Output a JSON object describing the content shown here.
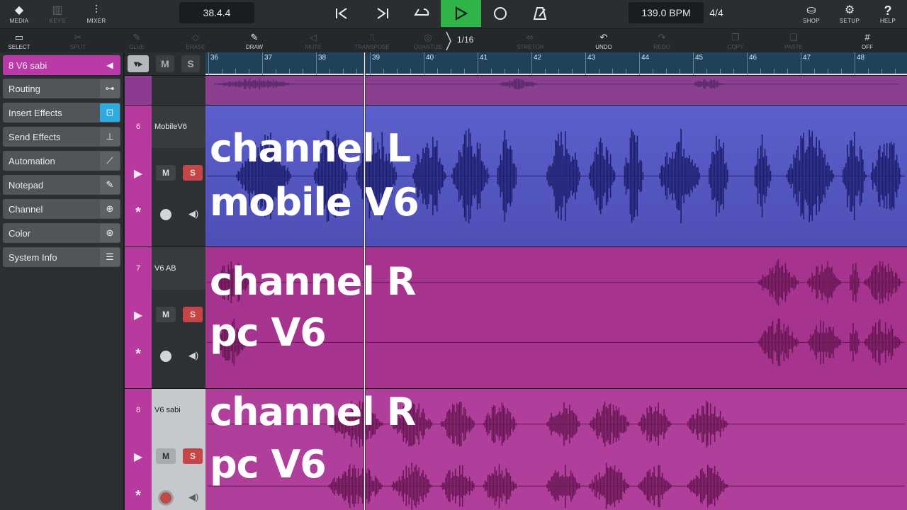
{
  "topbar": {
    "media_label": "MEDIA",
    "keys_label": "KEYS",
    "mixer_label": "MIXER",
    "position": "38.4.4",
    "tempo": "139.0 BPM",
    "signature": "4/4",
    "shop_label": "SHOP",
    "setup_label": "SETUP",
    "help_label": "HELP"
  },
  "tools": {
    "select": "SELECT",
    "split": "SPLIT",
    "glue": "GLUE",
    "erase": "ERASE",
    "draw": "DRAW",
    "mute": "MUTE",
    "transpose": "TRANSPOSE",
    "quantize": "QUANTIZE",
    "quantize_value": "1/16",
    "stretch": "STRETCH",
    "undo": "UNDO",
    "redo": "REDO",
    "copy": "COPY",
    "paste": "PASTE",
    "grid": "OFF"
  },
  "inspector": {
    "track_title": "8  V6 sabi",
    "items": [
      {
        "label": "Routing"
      },
      {
        "label": "Insert Effects"
      },
      {
        "label": "Send Effects"
      },
      {
        "label": "Automation"
      },
      {
        "label": "Notepad"
      },
      {
        "label": "Channel"
      },
      {
        "label": "Color"
      },
      {
        "label": "System Info"
      }
    ]
  },
  "header_buttons": {
    "mute": "M",
    "solo": "S"
  },
  "ruler": {
    "bars": [
      "36",
      "37",
      "38",
      "39",
      "40",
      "41",
      "42",
      "43",
      "44",
      "45",
      "46",
      "47",
      "48"
    ]
  },
  "tracks": [
    {
      "number": "6",
      "name": "MobileV6",
      "mute": "M",
      "solo": "S",
      "overlay_line1": "channel L",
      "overlay_line2": "mobile V6"
    },
    {
      "number": "7",
      "name": "V6 AB",
      "mute": "M",
      "solo": "S",
      "overlay_line1": "channel R",
      "overlay_line2": "pc V6"
    },
    {
      "number": "8",
      "name": "V6 sabi",
      "mute": "M",
      "solo": "S",
      "overlay_line1": "channel R",
      "overlay_line2": "pc V6"
    }
  ],
  "colors": {
    "accent_green": "#2fb44a",
    "track_magenta": "#b83a9f",
    "track_blue": "#5a5cc3",
    "wave_dark_blue": "#1c1f6e",
    "wave_dark_magenta": "#6a1755"
  }
}
